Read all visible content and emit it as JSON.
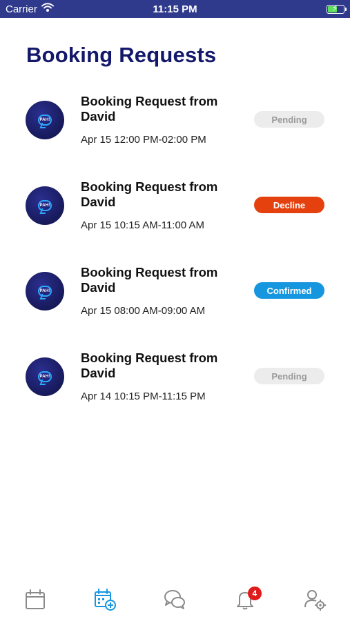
{
  "status_bar": {
    "carrier": "Carrier",
    "time": "11:15 PM",
    "wifi_icon": "wifi-icon",
    "battery_icon": "battery-charging-icon"
  },
  "page": {
    "title": "Booking Requests"
  },
  "requests": [
    {
      "title": "Booking Request from David",
      "time": "Apr 15 12:00 PM-02:00 PM",
      "status": "Pending",
      "avatar_text": "PAH!"
    },
    {
      "title": "Booking Request from David",
      "time": "Apr 15 10:15 AM-11:00 AM",
      "status": "Decline",
      "avatar_text": "PAH!"
    },
    {
      "title": "Booking Request from David",
      "time": "Apr 15 08:00 AM-09:00 AM",
      "status": "Confirmed",
      "avatar_text": "PAH!"
    },
    {
      "title": "Booking Request from David",
      "time": "Apr 14 10:15 PM-11:15 PM",
      "status": "Pending",
      "avatar_text": "PAH!"
    }
  ],
  "tab_bar": {
    "items": [
      {
        "icon": "calendar-icon",
        "active": false
      },
      {
        "icon": "calendar-add-icon",
        "active": true
      },
      {
        "icon": "chat-icon",
        "active": false
      },
      {
        "icon": "bell-icon",
        "active": false,
        "badge": "4"
      },
      {
        "icon": "user-settings-icon",
        "active": false
      }
    ]
  },
  "colors": {
    "status_bar": "#2f3a8c",
    "title": "#14186b",
    "pending_bg": "#ececec",
    "pending_text": "#9a9a9a",
    "decline": "#e4410e",
    "confirmed": "#1596df",
    "tab_inactive": "#8a8a8a",
    "tab_active": "#1596df",
    "notification_badge": "#e01b1b"
  }
}
